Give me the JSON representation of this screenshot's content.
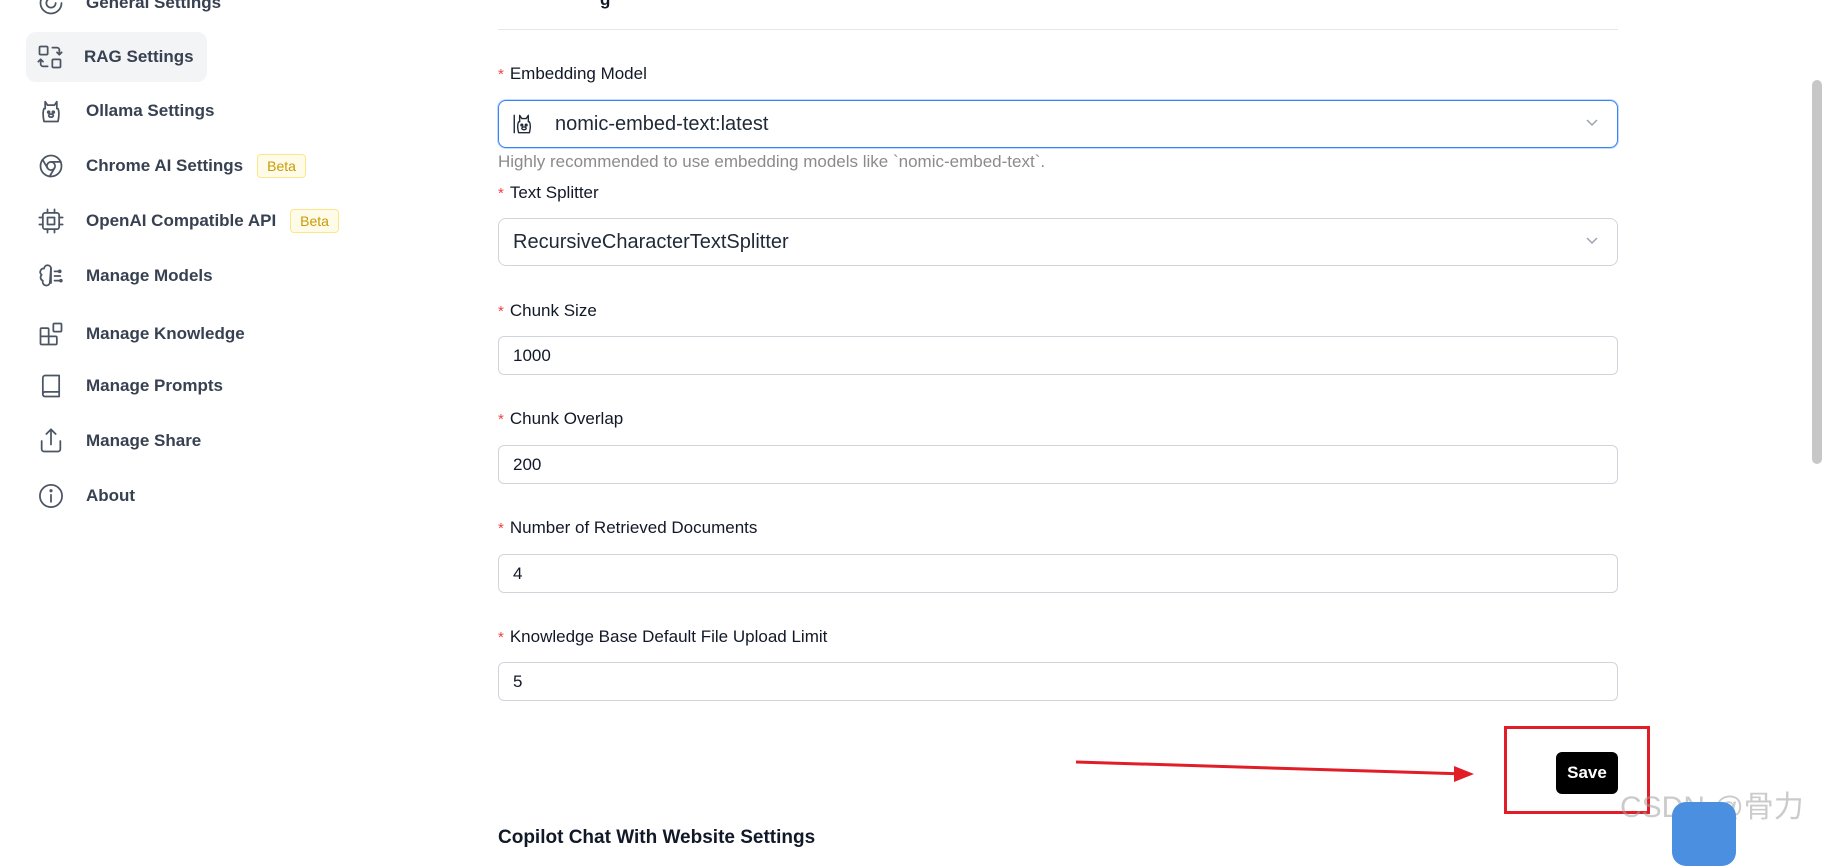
{
  "sidebar": {
    "items": [
      {
        "label": "General Settings",
        "icon": "general-settings-icon"
      },
      {
        "label": "RAG Settings",
        "icon": "rag-settings-icon",
        "active": true
      },
      {
        "label": "Ollama Settings",
        "icon": "ollama-icon"
      },
      {
        "label": "Chrome AI Settings",
        "icon": "chrome-icon",
        "badge": "Beta"
      },
      {
        "label": "OpenAI Compatible API",
        "icon": "chip-icon",
        "badge": "Beta"
      },
      {
        "label": "Manage Models",
        "icon": "brain-icon"
      },
      {
        "label": "Manage Knowledge",
        "icon": "blocks-icon"
      },
      {
        "label": "Manage Prompts",
        "icon": "book-icon"
      },
      {
        "label": "Manage Share",
        "icon": "share-icon"
      },
      {
        "label": "About",
        "icon": "info-icon"
      }
    ]
  },
  "form": {
    "top_heading_fragment": "g",
    "embedding_model": {
      "label": "Embedding Model",
      "value": "nomic-embed-text:latest",
      "icon": "ollama-icon",
      "help": "Highly recommended to use embedding models like `nomic-embed-text`."
    },
    "text_splitter": {
      "label": "Text Splitter",
      "value": "RecursiveCharacterTextSplitter"
    },
    "chunk_size": {
      "label": "Chunk Size",
      "value": "1000"
    },
    "chunk_overlap": {
      "label": "Chunk Overlap",
      "value": "200"
    },
    "retrieved_docs": {
      "label": "Number of Retrieved Documents",
      "value": "4"
    },
    "upload_limit": {
      "label": "Knowledge Base Default File Upload Limit",
      "value": "5"
    },
    "required_mark": "*",
    "save_label": "Save"
  },
  "next_section_title": "Copilot Chat With Website Settings",
  "watermark": "CSDN @骨力",
  "colors": {
    "accent_focus": "#3b82f6",
    "required": "#ef4444",
    "annotation_red": "#e11d27",
    "beta_text": "#ca9a04",
    "save_bg": "#000000"
  }
}
